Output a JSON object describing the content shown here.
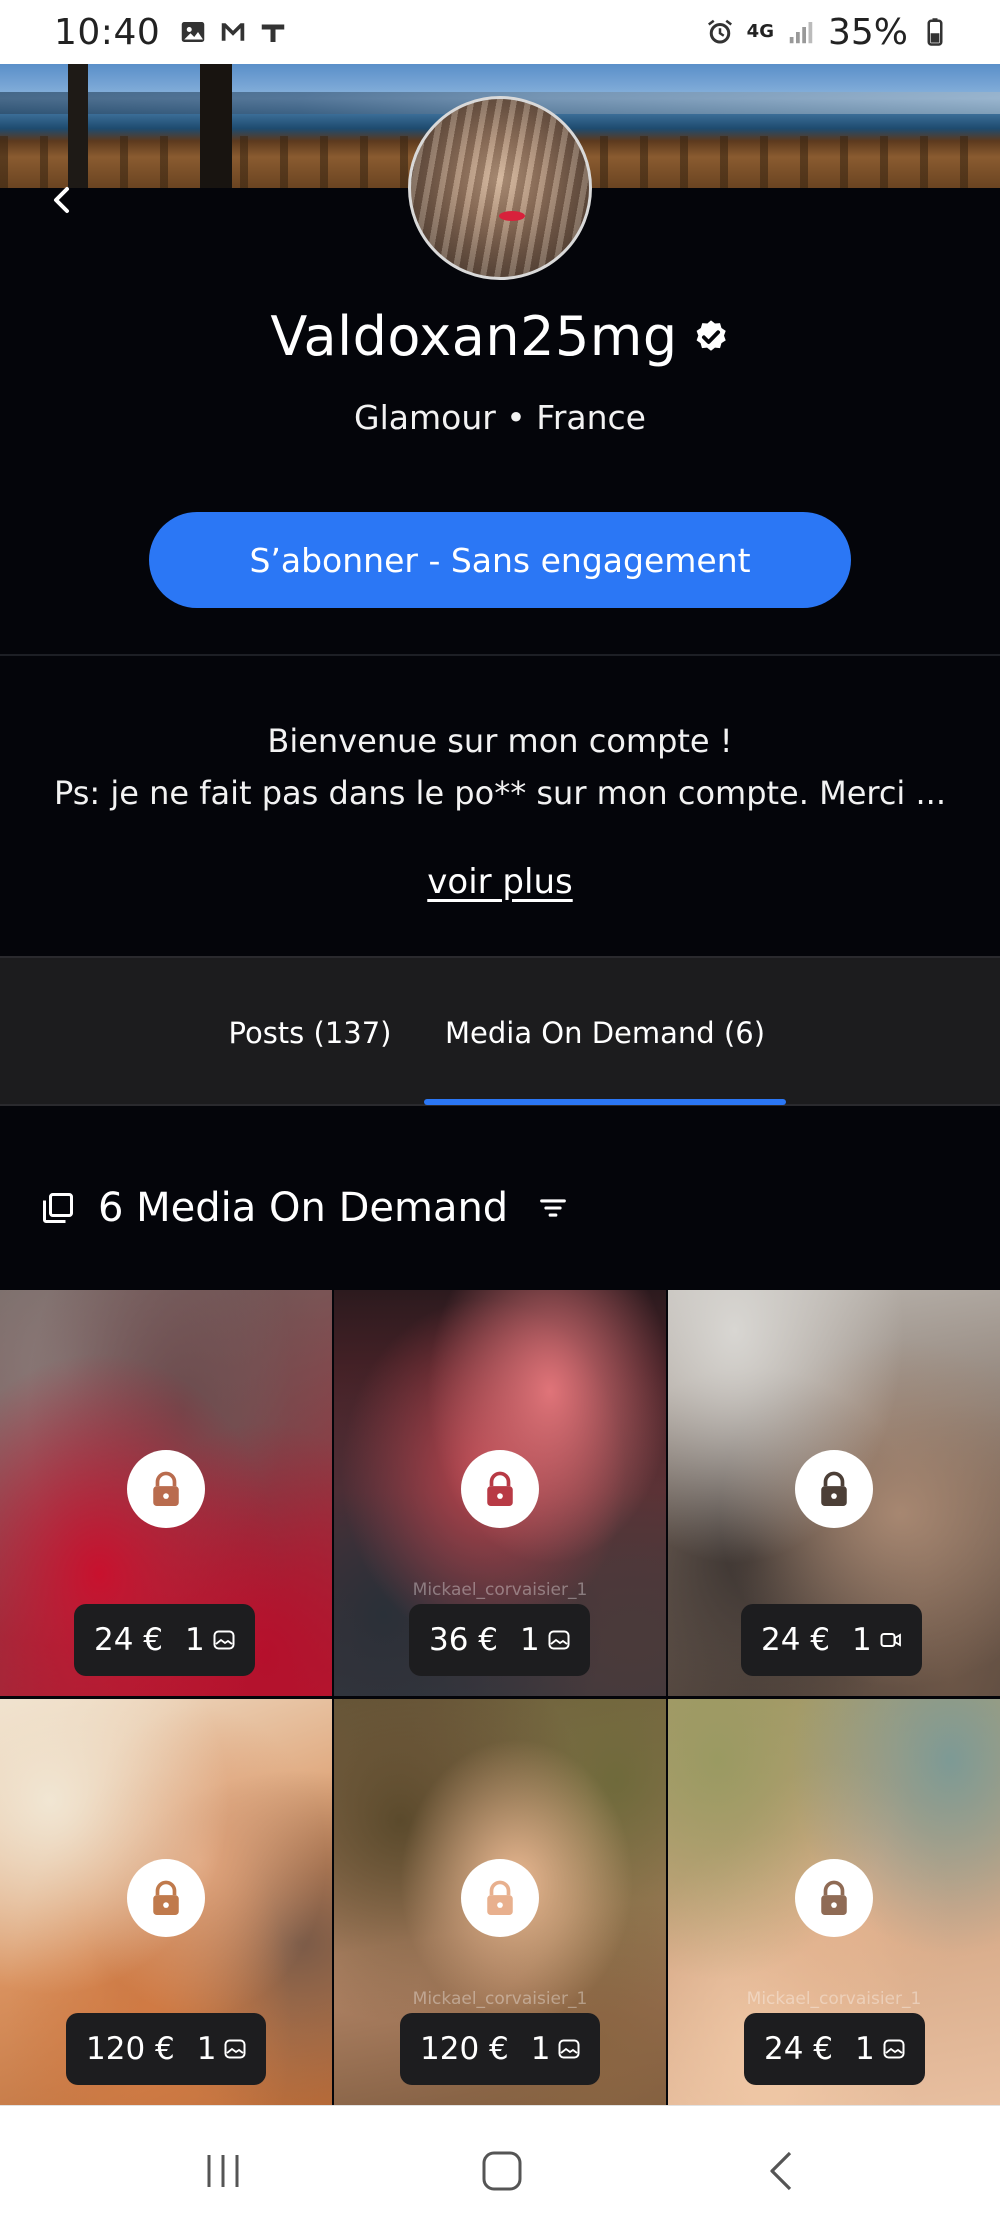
{
  "status_bar": {
    "time": "10:40",
    "battery": "35%",
    "network": "4G",
    "icons": [
      "gallery-icon",
      "gmail-icon",
      "app-icon",
      "alarm-icon",
      "signal-icon",
      "battery-icon"
    ]
  },
  "profile": {
    "name": "Valdoxan25mg",
    "verified": true,
    "meta": "Glamour • France",
    "subscribe_label": "S’abonner - Sans engagement",
    "bio_line1": "Bienvenue sur mon compte !",
    "bio_line2": "Ps: je ne fait pas dans le po** sur mon compte. Merci ...",
    "see_more": "voir plus"
  },
  "tabs": [
    {
      "label": "Posts (137)",
      "active": false
    },
    {
      "label": "Media On Demand (6)",
      "active": true
    }
  ],
  "section": {
    "title": "6 Media On Demand"
  },
  "media": [
    {
      "price": "24 €",
      "count": "1",
      "kind": "image-icon",
      "watermark": ""
    },
    {
      "price": "36 €",
      "count": "1",
      "kind": "image-icon",
      "watermark": "Mickael_corvaisier_1"
    },
    {
      "price": "24 €",
      "count": "1",
      "kind": "video-icon",
      "watermark": ""
    },
    {
      "price": "120 €",
      "count": "1",
      "kind": "image-icon",
      "watermark": ""
    },
    {
      "price": "120 €",
      "count": "1",
      "kind": "image-icon",
      "watermark": "Mickael_corvaisier_1"
    },
    {
      "price": "24 €",
      "count": "1",
      "kind": "image-icon",
      "watermark": "Mickael_corvaisier_1"
    }
  ],
  "colors": {
    "accent": "#2b77f5",
    "background": "#04050a",
    "tab_bar": "#1c1c1e"
  }
}
